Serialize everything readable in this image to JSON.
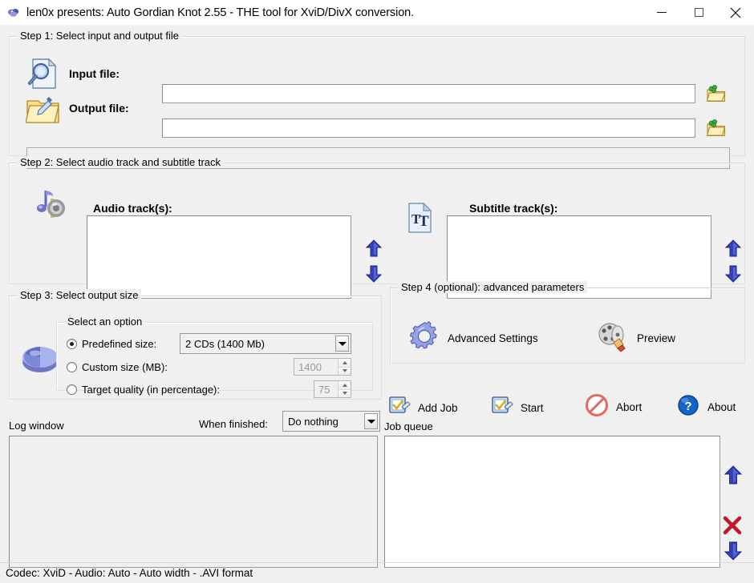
{
  "window": {
    "title": "len0x presents: Auto Gordian Knot 2.55 - THE tool for XviD/DivX conversion.",
    "icon": "app-knot-icon",
    "minimize_label": "Minimize",
    "maximize_label": "Maximize",
    "close_label": "Close"
  },
  "step1": {
    "title": "Step 1: Select input and output file",
    "input_label": "Input file:",
    "input_value": "",
    "input_icon": "document-search-icon",
    "input_browse_icon": "open-folder-icon",
    "output_label": "Output file:",
    "output_value": "",
    "output_icon": "write-folder-icon",
    "output_browse_icon": "open-folder-icon",
    "status_field_value": ""
  },
  "step2": {
    "title": "Step 2: Select audio track and subtitle track",
    "audio_icon": "music-speaker-icon",
    "audio_label": "Audio track(s):",
    "audio_items": [],
    "audio_up_icon": "arrow-up-icon",
    "audio_down_icon": "arrow-down-icon",
    "subtitle_icon": "subtitle-tt-icon",
    "subtitle_label": "Subtitle track(s):",
    "subtitle_items": [],
    "subtitle_up_icon": "arrow-up-icon",
    "subtitle_down_icon": "arrow-down-icon"
  },
  "step3": {
    "title": "Step 3: Select output size",
    "inner_title": "Select an option",
    "size_icon": "pie-chart-icon",
    "options": [
      {
        "label": "Predefined size:",
        "selected": true
      },
      {
        "label": "Custom size (MB):",
        "selected": false
      },
      {
        "label": "Target quality (in percentage):",
        "selected": false
      }
    ],
    "predefined_value": "2 CDs (1400 Mb)",
    "custom_size_value": "1400",
    "target_quality_value": "75"
  },
  "step4": {
    "title": "Step 4 (optional): advanced parameters",
    "advanced_label": "Advanced Settings",
    "advanced_icon": "gear-icon",
    "preview_label": "Preview",
    "preview_icon": "film-reel-icon"
  },
  "actions": [
    {
      "label": "Add Job",
      "icon": "checkbox-pencil-icon"
    },
    {
      "label": "Start",
      "icon": "checkbox-pencil-icon"
    },
    {
      "label": "Abort",
      "icon": "no-entry-icon"
    },
    {
      "label": "About",
      "icon": "question-mark-icon"
    }
  ],
  "bottom": {
    "log_label": "Log window",
    "log_value": "",
    "when_finished_label": "When finished:",
    "when_finished_value": "Do nothing",
    "job_queue_label": "Job queue",
    "job_queue_items": [],
    "queue_up_icon": "arrow-up-icon",
    "queue_delete_icon": "red-x-icon",
    "queue_down_icon": "arrow-down-icon"
  },
  "status": {
    "text": "Codec: XviD -  Audio: Auto -  Auto width - .AVI format"
  },
  "colors": {
    "window_bg": "#f0f0f0",
    "titlebar_bg": "#ffffff",
    "field_bg": "#ffffff",
    "arrow_blue": "#2b39b5",
    "red": "#cc1f26",
    "accent_blue": "#1464b4"
  }
}
